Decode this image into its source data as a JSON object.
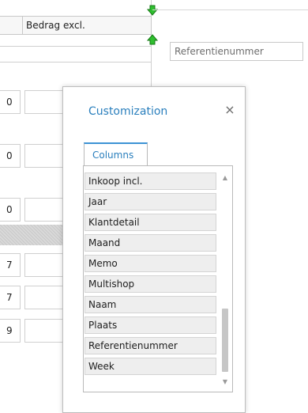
{
  "grid": {
    "header_label": "Bedrag excl.",
    "row_values": [
      "0",
      "0",
      "0",
      "7",
      "7",
      "9"
    ]
  },
  "reference_field": {
    "placeholder": "Referentienummer"
  },
  "dialog": {
    "title": "Customization",
    "close_glyph": "×",
    "tabs": [
      {
        "label": "Columns"
      }
    ],
    "columns": [
      "Inkoop incl.",
      "Jaar",
      "Klantdetail",
      "Maand",
      "Memo",
      "Multishop",
      "Naam",
      "Plaats",
      "Referentienummer",
      "Week"
    ],
    "scrollbar": {
      "up_glyph": "▲",
      "down_glyph": "▼"
    }
  },
  "colors": {
    "accent": "#2a7fbd",
    "drop_arrow": "#2fbf2f",
    "grid_line": "#cfcfcf"
  },
  "icons": {
    "drop_arrow_down": "green-down-arrow-icon",
    "drop_arrow_up": "green-up-arrow-icon",
    "close": "close-icon"
  }
}
